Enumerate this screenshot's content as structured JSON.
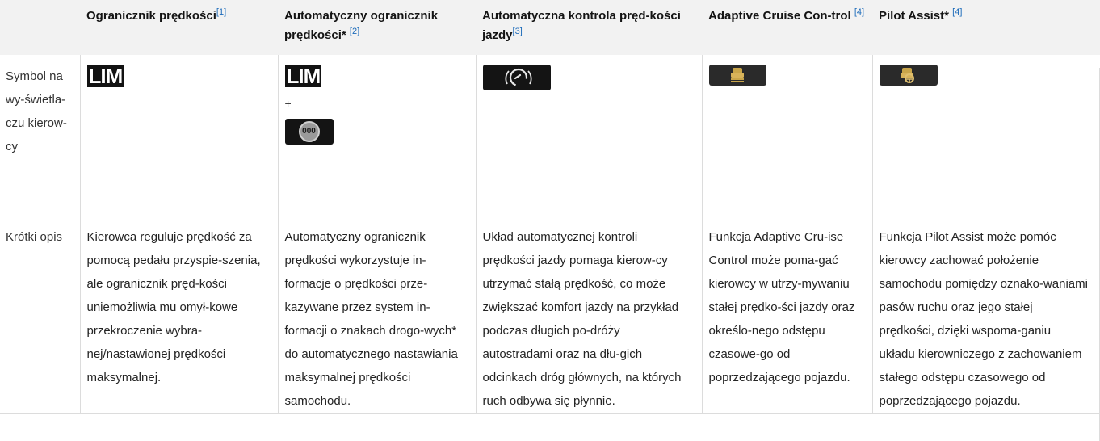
{
  "header": {
    "col1": {
      "text": "Ogranicznik prędkości",
      "ref": "[1]"
    },
    "col2": {
      "text": "Automatyczny ogranicznik prędkości",
      "star": "*",
      "ref": "[2]"
    },
    "col3": {
      "text": "Automatyczna kontrola pręd-kości jazdy",
      "ref": "[3]"
    },
    "col4": {
      "text": "Adaptive Cruise Con-trol",
      "ref": "[4]"
    },
    "col5": {
      "text": "Pilot Assist",
      "star": "*",
      "ref": "[4]"
    }
  },
  "rows": {
    "symbol": {
      "label": "Symbol na wy-świetla-czu kierow-cy",
      "lim_text": "LIM",
      "lim_text2": "LIM",
      "plus": "+",
      "asl_badge_text": "000",
      "icons": [
        "lim-icon",
        "lim-icon",
        "auto-speed-limit-icon",
        "cruise-control-icon",
        "adaptive-cruise-control-icon",
        "pilot-assist-icon"
      ]
    },
    "description": {
      "label": "Krótki opis",
      "col1": "Kierowca reguluje prędkość za pomocą pedału przyspie-szenia, ale ogranicznik pręd-kości uniemożliwia mu omył-kowe przekroczenie wybra-nej/nastawionej prędkości maksymalnej.",
      "col2": "Automatyczny ogranicznik prędkości wykorzystuje in-formacje o prędkości prze-kazywane przez system in-formacji o znakach drogo-wych* do automatycznego nastawiania maksymalnej prędkości samochodu.",
      "col3": "Układ automatycznej kontroli prędkości jazdy pomaga kierow-cy utrzymać stałą prędkość, co może zwiększać komfort jazdy na przykład podczas długich po-dróży autostradami oraz na dłu-gich odcinkach dróg głównych, na których ruch odbywa się płynnie.",
      "col4": "Funkcja Adaptive Cru-ise Control może poma-gać kierowcy w utrzy-mywaniu stałej prędko-ści jazdy oraz określo-nego odstępu czasowe-go od poprzedzającego pojazdu.",
      "col5": "Funkcja Pilot Assist może pomóc kierowcy zachować położenie samochodu pomiędzy oznako-waniami pasów ruchu oraz jego stałej prędkości, dzięki wspoma-ganiu układu kierowniczego z zachowaniem stałego odstępu czasowego od poprzedzającego pojazdu."
    }
  },
  "colors": {
    "header_bg": "#f2f2f2",
    "ref_blue": "#1c6bba",
    "icon_amber": "#c9a54a",
    "icon_bg": "#2a2a2a"
  }
}
